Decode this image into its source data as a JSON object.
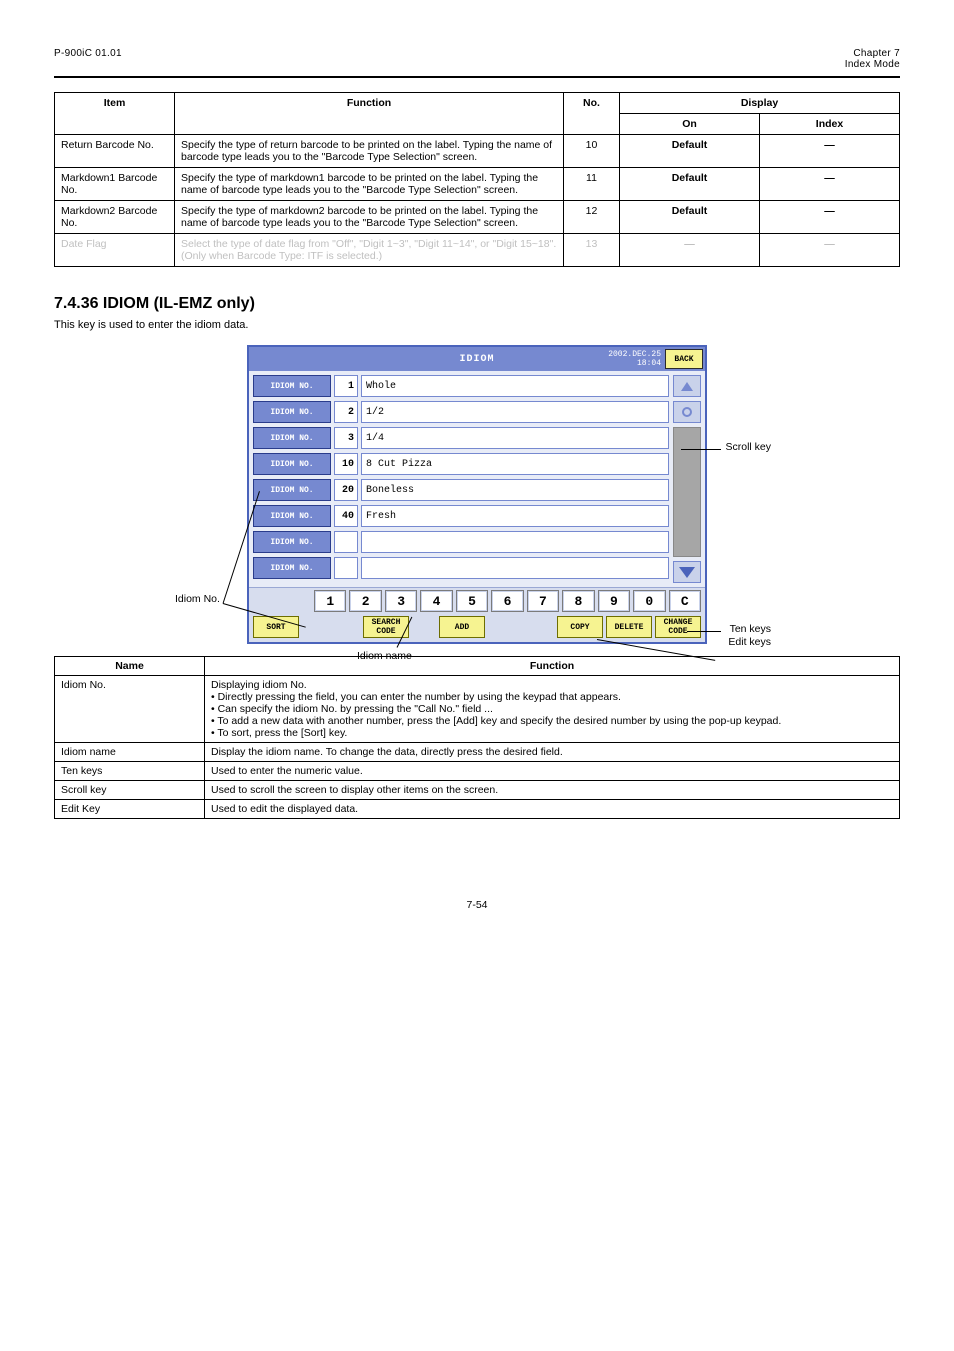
{
  "running_header": {
    "left": "P-900iC  01.01",
    "right_line1": "Chapter 7",
    "right_line2": "Index Mode"
  },
  "spec_table": {
    "headers": {
      "item": "Item",
      "func": "Function",
      "no": "No.",
      "disp_group": "Display",
      "disp_head": "On",
      "disp_ind": "Index"
    },
    "rows": [
      {
        "item": "Return Barcode No.",
        "func": "Specify the type of return barcode to be printed on the label. Typing the name of barcode type leads you to the \"Barcode Type Selection\" screen.",
        "no": "10",
        "disp_head": "Default",
        "disp_ind": "—"
      },
      {
        "item": "Markdown1 Barcode No.",
        "func": "Specify the type of markdown1 barcode to be printed on the label. Typing the name of barcode type leads you to the \"Barcode Type Selection\" screen.",
        "no": "11",
        "disp_head": "Default",
        "disp_ind": "—"
      },
      {
        "item": "Markdown2 Barcode No.",
        "func": "Specify the type of markdown2 barcode to be printed on the label. Typing the name of barcode type leads you to the \"Barcode Type Selection\" screen.",
        "no": "12",
        "disp_head": "Default",
        "disp_ind": "—"
      },
      {
        "item": "Date Flag",
        "func": "Select the type of date flag from \"Off\", \"Digit 1~3\", \"Digit 11~14\", or \"Digit 15~18\".  (Only when Barcode Type: ITF is selected.)",
        "no": "13",
        "disp_head": "—",
        "disp_ind": "—",
        "bad": true
      }
    ]
  },
  "section_heading": "7.4.36  IDIOM (IL-EMZ only)",
  "section_blurb": "This key is used to enter the idiom data.",
  "shot": {
    "title": "IDIOM",
    "timestamp": "2002.DEC.25\n18:04",
    "back_label": "BACK",
    "row_label": "IDIOM NO.",
    "rows": [
      {
        "no": "1",
        "val": "Whole"
      },
      {
        "no": "2",
        "val": "1/2"
      },
      {
        "no": "3",
        "val": "1/4"
      },
      {
        "no": "10",
        "val": "8 Cut Pizza"
      },
      {
        "no": "20",
        "val": "Boneless"
      },
      {
        "no": "40",
        "val": "Fresh"
      },
      {
        "no": "",
        "val": ""
      },
      {
        "no": "",
        "val": ""
      }
    ],
    "numpad": [
      "1",
      "2",
      "3",
      "4",
      "5",
      "6",
      "7",
      "8",
      "9",
      "0",
      "C"
    ],
    "cmd": {
      "sort": "SORT",
      "search": "SEARCH\nCODE",
      "add": "ADD",
      "copy": "COPY",
      "delete": "DELETE",
      "change": "CHANGE\nCODE"
    }
  },
  "callouts": {
    "idiom_no": "Idiom No.",
    "idiom_name": "Idiom name",
    "scroll": "Scroll key",
    "ten_keys": "Ten keys",
    "edit_keys": "Edit keys"
  },
  "expl_table": {
    "headers": {
      "name": "Name",
      "func": "Function"
    },
    "rows": [
      {
        "name": "Idiom No.",
        "func_lines": [
          "Displaying idiom No.",
          "• Directly pressing the field, you can enter the number by using the keypad that appears.",
          "• Can specify the idiom No. by pressing the \"Call No.\" field ...",
          "• To add a new data with another number, press the [Add] key and specify the desired number by using the pop-up keypad.",
          "• To sort, press the [Sort] key."
        ]
      },
      {
        "name": "Idiom name",
        "func_lines": [
          "Display the idiom name. To change the data, directly press the desired field."
        ]
      },
      {
        "name": "Ten keys",
        "func_lines": [
          "Used to enter the numeric value."
        ]
      },
      {
        "name": "Scroll key",
        "func_lines": [
          "Used to scroll the screen to display other items on the screen."
        ]
      },
      {
        "name": "Edit Key",
        "func_lines": [
          "Used to edit the displayed data."
        ]
      }
    ]
  },
  "page_number": "7-54"
}
